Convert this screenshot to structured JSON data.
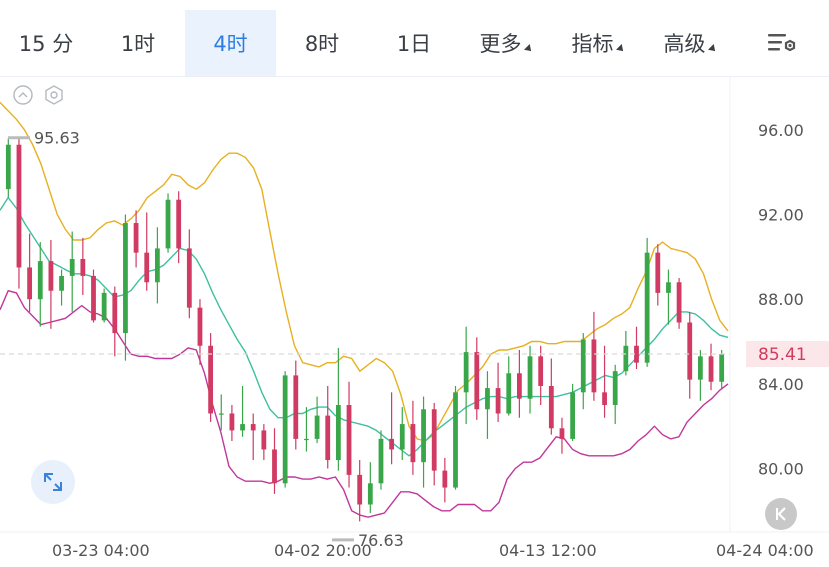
{
  "tabs": [
    {
      "label": "15 分",
      "active": false
    },
    {
      "label": "1时",
      "active": false
    },
    {
      "label": "4时",
      "active": true
    },
    {
      "label": "8时",
      "active": false
    },
    {
      "label": "1日",
      "active": false
    },
    {
      "label": "更多",
      "active": false,
      "dropdown": true
    },
    {
      "label": "指标",
      "active": false,
      "dropdown": true
    },
    {
      "label": "高级",
      "active": false,
      "dropdown": true
    }
  ],
  "icons": {
    "settings": "settings-list-icon",
    "toggle": "chevron-up-circle-icon",
    "hex": "hexagon-settings-icon",
    "expand": "expand-arrows-icon",
    "back": "skip-back-icon"
  },
  "price_axis": [
    "96.00",
    "92.00",
    "88.00",
    "84.00",
    "80.00"
  ],
  "current_price": "85.41",
  "high_marker": "95.63",
  "low_marker": "76.63",
  "time_axis": [
    "03-23 04:00",
    "04-02 20:00",
    "04-13 12:00",
    "04-24 04:00"
  ],
  "colors": {
    "up": "#3aa64a",
    "down": "#d03a63",
    "active_tab": "#2f7de1",
    "upper_band": "#e6b021",
    "mid_band": "#3ec0a0",
    "lower_band": "#c0379a",
    "price_line": "#d9d9d9"
  },
  "chart_data": {
    "type": "candlestick",
    "ylim": [
      77.0,
      98.5
    ],
    "series": [
      {
        "name": "upper",
        "values": [
          97.3,
          96.9,
          96.5,
          96.0,
          95.3,
          94.4,
          93.2,
          92.0,
          91.3,
          90.8,
          90.8,
          90.9,
          91.3,
          91.6,
          91.7,
          91.5,
          91.8,
          92.2,
          92.8,
          93.1,
          93.4,
          93.9,
          93.8,
          93.4,
          93.2,
          93.5,
          94.1,
          94.6,
          94.9,
          94.9,
          94.7,
          94.2,
          93.2,
          91.2,
          89.2,
          87.4,
          85.8,
          85.0,
          84.9,
          84.8,
          85.0,
          85.0,
          85.3,
          85.2,
          84.6,
          84.9,
          85.2,
          85.0,
          84.6,
          83.5,
          82.0,
          81.4,
          81.3,
          81.6,
          82.3,
          83.0,
          83.7,
          84.0,
          84.4,
          84.8,
          85.4,
          85.6,
          85.6,
          85.7,
          85.8,
          86.0,
          86.0,
          85.9,
          85.9,
          86.0,
          86.0,
          86.0,
          86.3,
          86.6,
          86.8,
          87.1,
          87.3,
          87.6,
          88.5,
          89.3,
          90.4,
          90.7,
          90.4,
          90.3,
          90.2,
          89.9,
          89.2,
          88.0,
          87.0,
          86.5
        ]
      },
      {
        "name": "mid",
        "values": [
          92.2,
          92.8,
          92.3,
          91.6,
          91.0,
          90.4,
          89.8,
          89.6,
          89.4,
          89.2,
          89.2,
          89.1,
          88.9,
          88.5,
          88.1,
          88.2,
          88.4,
          88.9,
          89.3,
          89.4,
          89.6,
          90.0,
          90.4,
          90.3,
          89.9,
          89.2,
          88.3,
          87.5,
          86.8,
          86.1,
          85.5,
          84.6,
          83.6,
          82.8,
          82.4,
          82.4,
          82.6,
          82.6,
          82.8,
          82.9,
          82.9,
          82.5,
          82.3,
          82.2,
          82.1,
          82.0,
          81.8,
          81.5,
          81.2,
          80.9,
          80.6,
          80.9,
          81.3,
          81.7,
          82.0,
          82.3,
          82.6,
          82.9,
          83.1,
          83.3,
          83.4,
          83.4,
          83.3,
          83.4,
          83.4,
          83.4,
          83.4,
          83.4,
          83.4,
          83.5,
          83.6,
          83.8,
          84.0,
          84.2,
          84.4,
          84.3,
          84.5,
          84.9,
          85.3,
          85.7,
          86.1,
          86.6,
          87.0,
          87.4,
          87.4,
          87.3,
          87.0,
          86.6,
          86.3,
          86.2
        ]
      },
      {
        "name": "lower",
        "values": [
          87.5,
          88.4,
          88.3,
          87.6,
          87.2,
          86.8,
          86.9,
          87.0,
          87.1,
          87.4,
          87.7,
          87.4,
          87.3,
          87.1,
          86.6,
          86.0,
          85.4,
          85.3,
          85.3,
          85.2,
          85.2,
          85.2,
          85.4,
          85.7,
          85.6,
          84.5,
          83.0,
          81.7,
          80.1,
          79.6,
          79.4,
          79.4,
          79.4,
          79.3,
          79.4,
          79.6,
          79.6,
          79.5,
          79.5,
          79.6,
          79.5,
          79.6,
          79.0,
          78.0,
          77.8,
          77.7,
          77.8,
          77.9,
          78.4,
          78.9,
          78.9,
          78.8,
          78.5,
          78.2,
          78.0,
          78.0,
          78.3,
          78.3,
          78.3,
          78.0,
          78.0,
          78.4,
          79.5,
          80.0,
          80.3,
          80.3,
          80.5,
          81.0,
          81.5,
          81.4,
          80.9,
          80.7,
          80.6,
          80.6,
          80.6,
          80.6,
          80.7,
          80.9,
          81.3,
          81.6,
          82.0,
          81.6,
          81.4,
          81.5,
          82.2,
          82.6,
          83.0,
          83.3,
          83.7,
          84.0
        ]
      }
    ],
    "candles": [
      [
        93.2,
        95.6,
        92.8,
        95.3
      ],
      [
        95.3,
        95.6,
        88.5,
        89.5
      ],
      [
        89.5,
        91.1,
        87.4,
        88.0
      ],
      [
        88.0,
        90.7,
        86.7,
        89.8
      ],
      [
        89.8,
        90.8,
        86.6,
        88.4
      ],
      [
        88.4,
        89.4,
        87.7,
        89.1
      ],
      [
        89.1,
        91.2,
        87.4,
        89.9
      ],
      [
        89.9,
        90.9,
        88.2,
        89.1
      ],
      [
        89.1,
        89.4,
        86.9,
        87.0
      ],
      [
        87.0,
        88.5,
        86.9,
        88.3
      ],
      [
        88.3,
        88.6,
        85.3,
        86.4
      ],
      [
        86.4,
        92.0,
        85.1,
        91.6
      ],
      [
        91.6,
        92.2,
        89.5,
        90.2
      ],
      [
        90.2,
        92.1,
        88.4,
        88.8
      ],
      [
        88.8,
        91.4,
        87.8,
        90.4
      ],
      [
        90.4,
        93.0,
        90.2,
        92.7
      ],
      [
        92.7,
        93.1,
        89.7,
        90.4
      ],
      [
        90.4,
        91.3,
        87.1,
        87.6
      ],
      [
        87.6,
        88.0,
        84.9,
        85.8
      ],
      [
        85.8,
        86.4,
        82.2,
        82.6
      ],
      [
        82.6,
        83.5,
        81.8,
        82.6
      ],
      [
        82.6,
        83.0,
        81.3,
        81.8
      ],
      [
        81.8,
        83.9,
        81.5,
        82.1
      ],
      [
        82.1,
        82.6,
        80.4,
        81.8
      ],
      [
        81.8,
        82.1,
        80.4,
        80.9
      ],
      [
        80.9,
        81.9,
        78.8,
        79.3
      ],
      [
        79.3,
        84.6,
        79.1,
        84.4
      ],
      [
        84.4,
        85.1,
        80.9,
        81.4
      ],
      [
        81.4,
        82.9,
        80.8,
        81.4
      ],
      [
        81.4,
        83.4,
        81.2,
        82.5
      ],
      [
        82.5,
        83.9,
        80.0,
        80.4
      ],
      [
        80.4,
        85.7,
        79.9,
        83.0
      ],
      [
        83.0,
        84.1,
        79.1,
        79.7
      ],
      [
        79.7,
        80.4,
        77.5,
        78.3
      ],
      [
        78.3,
        80.3,
        77.9,
        79.3
      ],
      [
        79.3,
        81.8,
        79.0,
        81.4
      ],
      [
        81.4,
        83.6,
        80.2,
        80.9
      ],
      [
        80.9,
        82.9,
        80.4,
        82.1
      ],
      [
        82.1,
        83.2,
        79.7,
        80.3
      ],
      [
        80.3,
        83.4,
        79.1,
        82.8
      ],
      [
        82.8,
        83.1,
        79.2,
        79.9
      ],
      [
        79.9,
        80.5,
        78.4,
        79.1
      ],
      [
        79.1,
        83.9,
        79.0,
        83.6
      ],
      [
        83.6,
        86.7,
        82.1,
        85.5
      ],
      [
        85.5,
        86.2,
        82.3,
        82.8
      ],
      [
        82.8,
        84.6,
        81.4,
        83.8
      ],
      [
        83.8,
        85.0,
        82.2,
        82.6
      ],
      [
        82.6,
        85.3,
        82.5,
        84.5
      ],
      [
        84.5,
        85.6,
        82.4,
        83.3
      ],
      [
        83.3,
        85.8,
        82.6,
        85.3
      ],
      [
        85.3,
        85.8,
        83.0,
        83.9
      ],
      [
        83.9,
        85.2,
        81.6,
        81.9
      ],
      [
        81.9,
        82.4,
        80.7,
        81.4
      ],
      [
        81.4,
        84.0,
        81.3,
        83.6
      ],
      [
        83.6,
        86.4,
        82.8,
        86.1
      ],
      [
        86.1,
        87.4,
        83.2,
        83.6
      ],
      [
        83.6,
        85.8,
        82.4,
        83.0
      ],
      [
        83.0,
        84.9,
        82.1,
        84.6
      ],
      [
        84.6,
        86.5,
        84.4,
        85.8
      ],
      [
        85.8,
        86.7,
        84.7,
        85.0
      ],
      [
        85.0,
        90.9,
        84.8,
        90.2
      ],
      [
        90.2,
        90.6,
        87.7,
        88.3
      ],
      [
        88.3,
        89.4,
        86.8,
        88.8
      ],
      [
        88.8,
        89.0,
        86.6,
        86.9
      ],
      [
        86.9,
        87.4,
        83.3,
        84.2
      ],
      [
        84.2,
        85.6,
        83.2,
        85.3
      ],
      [
        85.3,
        85.9,
        83.7,
        84.1
      ],
      [
        84.1,
        85.6,
        83.8,
        85.4
      ]
    ]
  }
}
